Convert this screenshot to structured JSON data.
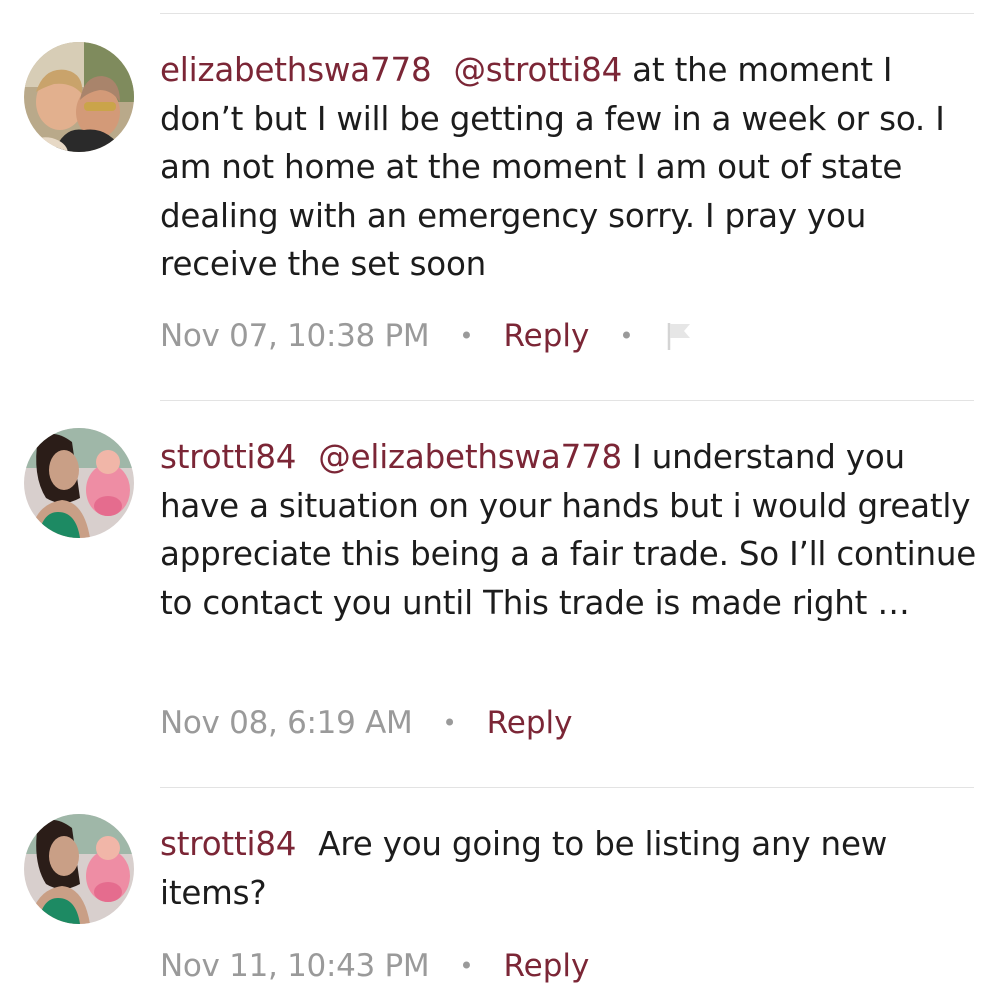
{
  "comments": [
    {
      "username": "elizabethswa778",
      "mention": "@strotti84",
      "text": " at the moment I don’t but I will be getting a few in a week or so. I am not home at the moment I am out of state dealing with an emergency sorry. I pray you receive the set soon",
      "timestamp": "Nov 07, 10:38 PM",
      "reply_label": "Reply",
      "has_flag": true,
      "flag_icon": "flag-icon"
    },
    {
      "username": "strotti84",
      "mention": "@elizabethswa778",
      "text": " I understand you have a situation on your hands but i would greatly appreciate this being a a fair trade. So I’ll continue to contact you until This trade is made right …",
      "timestamp": "Nov 08, 6:19 AM",
      "reply_label": "Reply"
    },
    {
      "username": "strotti84",
      "text": "Are you going to be listing any new items?",
      "timestamp": "Nov 11, 10:43 PM",
      "reply_label": "Reply"
    }
  ],
  "separator": "•",
  "colors": {
    "username": "#7b2636",
    "reply": "#7b2636",
    "timestamp": "#9a9a9a",
    "divider": "#e3e3e3",
    "text": "#1c1c1c"
  }
}
